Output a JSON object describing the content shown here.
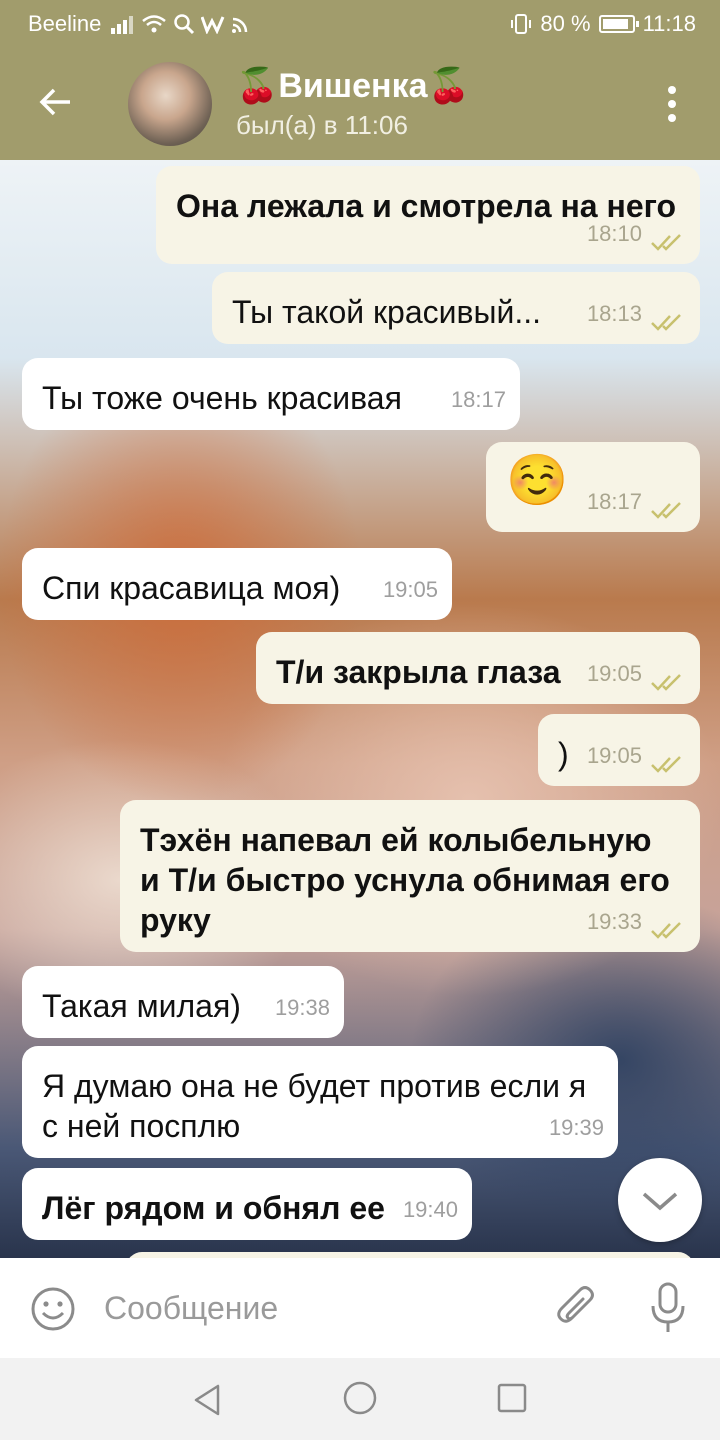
{
  "status_bar": {
    "carrier": "Beeline",
    "battery": "80 %",
    "time": "11:18"
  },
  "header": {
    "title": "🍒Вишенка🍒",
    "subtitle": "был(а) в 11:06"
  },
  "messages": [
    {
      "text": "Она лежала и смотрела на него",
      "time": "18:10"
    },
    {
      "text": "Ты такой красивый...",
      "time": "18:13"
    },
    {
      "text": "Ты тоже очень красивая",
      "time": "18:17"
    },
    {
      "text": "☺️",
      "time": "18:17"
    },
    {
      "text": "Спи красавица моя)",
      "time": "19:05"
    },
    {
      "text": "Т/и закрыла глаза",
      "time": "19:05"
    },
    {
      "text": ")",
      "time": "19:05"
    },
    {
      "text": "Тэхён напевал ей колыбельную и Т/и быстро уснула обнимая его руку",
      "time": "19:33"
    },
    {
      "text": "Такая милая)",
      "time": "19:38"
    },
    {
      "text": "Я думаю она не будет против если я с ней посплю",
      "time": "19:39"
    },
    {
      "text": "Лёг рядом и обнял ее",
      "time": "19:40"
    }
  ],
  "input": {
    "placeholder": "Сообщение"
  },
  "colors": {
    "accent": "#a19c6c",
    "outgoing_bubble": "#f7f4e6",
    "incoming_bubble": "#ffffff",
    "read_checks": "#c8c16e"
  },
  "icons": [
    "back-arrow-icon",
    "more-vert-icon",
    "emoji-icon",
    "attach-icon",
    "mic-icon",
    "scroll-down-icon"
  ]
}
